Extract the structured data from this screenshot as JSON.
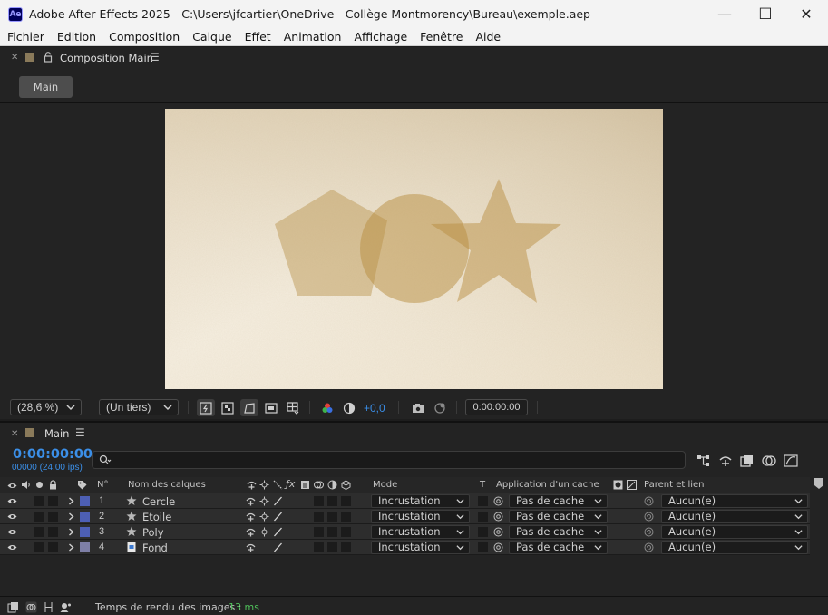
{
  "window": {
    "app_icon": "Ae",
    "title": "Adobe After Effects 2025 - C:\\Users\\jfcartier\\OneDrive - Collège Montmorency\\Bureau\\exemple.aep",
    "minimize": "—",
    "maximize": "☐",
    "close": "✕"
  },
  "menu": [
    "Fichier",
    "Edition",
    "Composition",
    "Calque",
    "Effet",
    "Animation",
    "Affichage",
    "Fenêtre",
    "Aide"
  ],
  "composition_panel": {
    "tab_label": "Composition Main",
    "comp_button": "Main",
    "magnification": "(28,6 %)",
    "resolution": "(Un tiers)",
    "exposure": "+0,0",
    "timecode": "0:00:00:00"
  },
  "timeline_panel": {
    "tab_label": "Main",
    "current_time": "0:00:00:00",
    "frame_info": "00000 (24.00 ips)",
    "search_placeholder": "",
    "columns": {
      "number": "N°",
      "layer_name": "Nom des calques",
      "mode": "Mode",
      "t": "T",
      "track_matte": "Application d'un cache",
      "parent": "Parent et lien"
    },
    "layers": [
      {
        "num": "1",
        "name": "Cercle",
        "type": "shape",
        "label_color": "#4d5fb4",
        "mode": "Incrustation",
        "track_matte": "Pas de cache",
        "parent": "Aucun(e)"
      },
      {
        "num": "2",
        "name": "Etoile",
        "type": "shape",
        "label_color": "#4d5fb4",
        "mode": "Incrustation",
        "track_matte": "Pas de cache",
        "parent": "Aucun(e)"
      },
      {
        "num": "3",
        "name": "Poly",
        "type": "shape",
        "label_color": "#4d5fb4",
        "mode": "Incrustation",
        "track_matte": "Pas de cache",
        "parent": "Aucun(e)"
      },
      {
        "num": "4",
        "name": "Fond",
        "type": "footage",
        "label_color": "#7e7fa6",
        "mode": "Incrustation",
        "track_matte": "Pas de cache",
        "parent": "Aucun(e)"
      }
    ],
    "render_time_label": "Temps de rendu des images :",
    "render_time_value": "13 ms"
  },
  "colors": {
    "accent_blue": "#3b8fe8",
    "render_green": "#4fc05a",
    "panel_bg": "#232323"
  }
}
